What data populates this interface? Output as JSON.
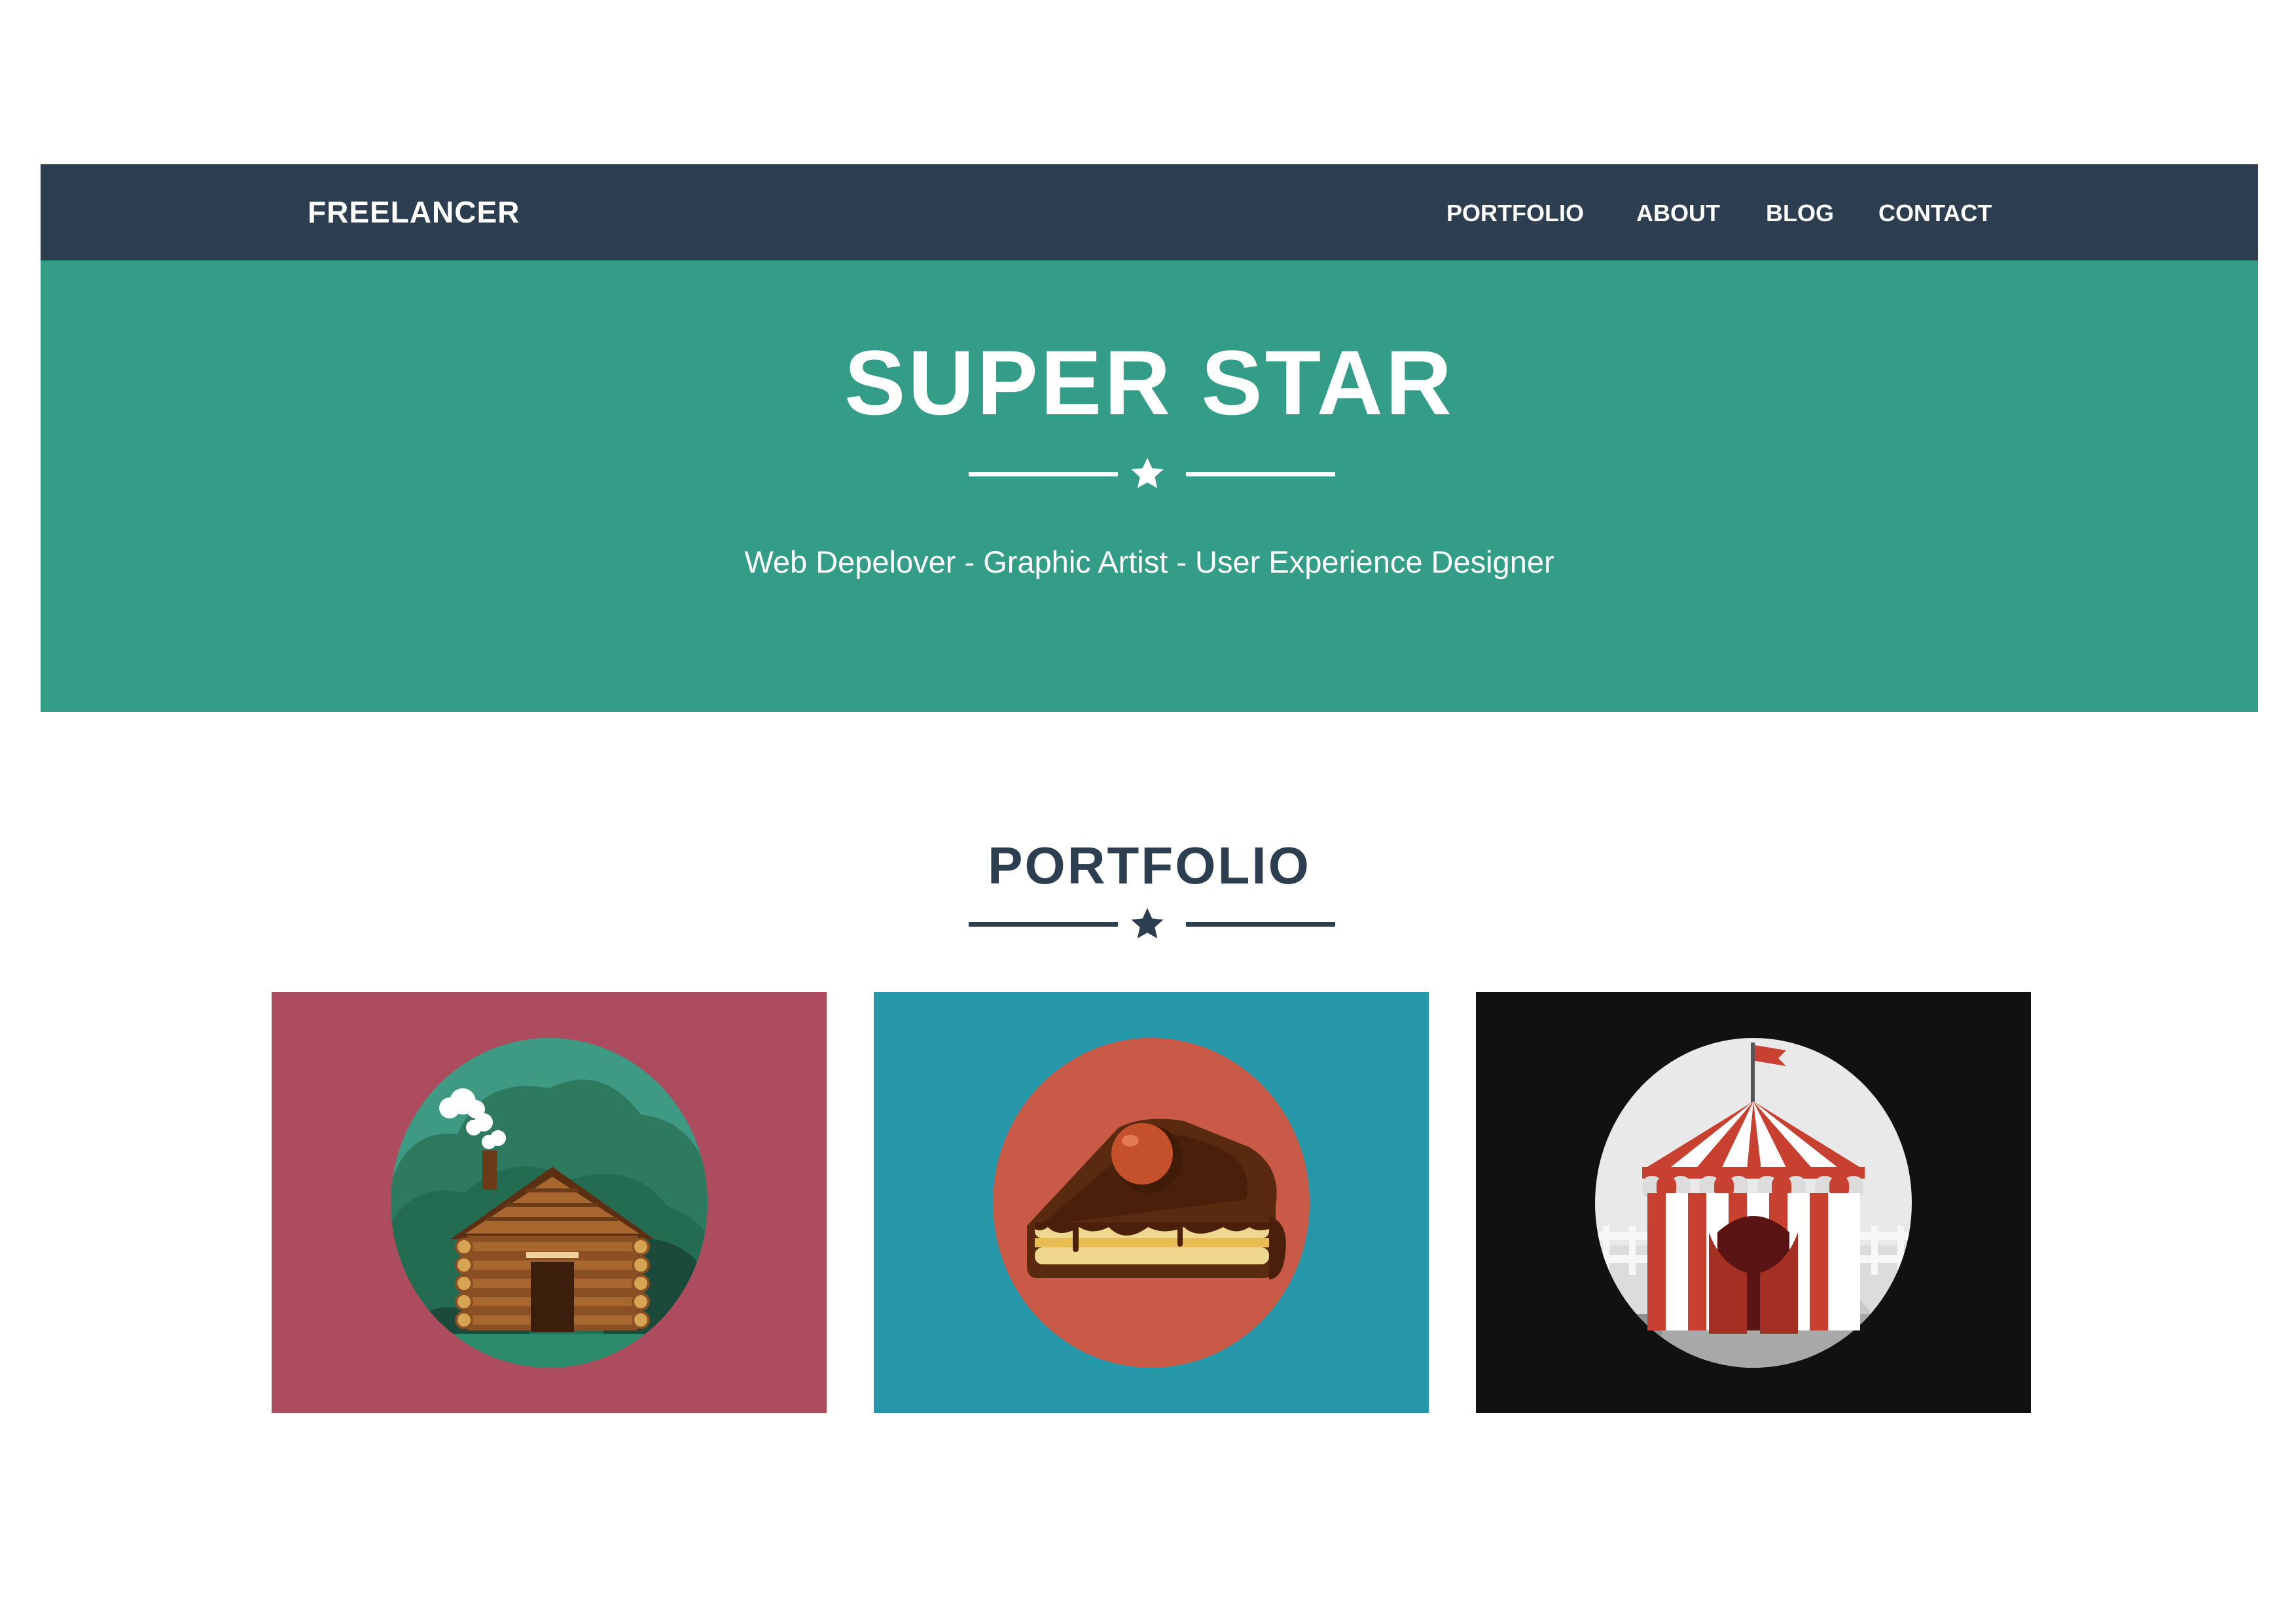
{
  "navbar": {
    "brand": "FREELANCER",
    "links": [
      {
        "label": "PORTFOLIO"
      },
      {
        "label": "ABOUT"
      },
      {
        "label": "BLOG"
      },
      {
        "label": "CONTACT"
      }
    ]
  },
  "header": {
    "title": "SUPER STAR",
    "subtitle": "Web Depelover - Graphic Artist - User Experience Designer",
    "divider_icon": "star-icon"
  },
  "portfolio": {
    "title": "PORTFOLIO",
    "divider_icon": "star-icon",
    "items": [
      {
        "icon": "log-cabin-icon",
        "background": "#ad4b5f"
      },
      {
        "icon": "cake-slice-icon",
        "background": "#2697a8"
      },
      {
        "icon": "circus-tent-icon",
        "background": "#111111"
      }
    ]
  },
  "colors": {
    "navbar": "#2c3e50",
    "header": "#339d88",
    "text_dark": "#2c3e50",
    "text_light": "#ffffff"
  }
}
